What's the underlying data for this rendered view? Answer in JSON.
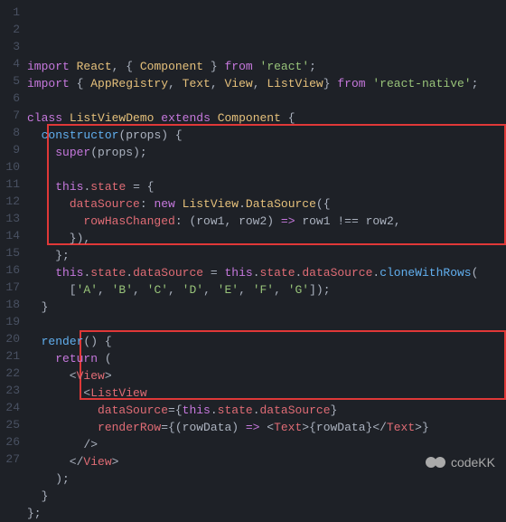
{
  "watermark": "codeKK",
  "lines": [
    {
      "num": "1",
      "tokens": [
        [
          "kw",
          "import"
        ],
        [
          "punc",
          " "
        ],
        [
          "cls",
          "React"
        ],
        [
          "punc",
          ", { "
        ],
        [
          "cls",
          "Component"
        ],
        [
          "punc",
          " } "
        ],
        [
          "kw",
          "from"
        ],
        [
          "punc",
          " "
        ],
        [
          "str",
          "'react'"
        ],
        [
          "punc",
          ";"
        ]
      ]
    },
    {
      "num": "2",
      "tokens": [
        [
          "kw",
          "import"
        ],
        [
          "punc",
          " { "
        ],
        [
          "cls",
          "AppRegistry"
        ],
        [
          "punc",
          ", "
        ],
        [
          "cls",
          "Text"
        ],
        [
          "punc",
          ", "
        ],
        [
          "cls",
          "View"
        ],
        [
          "punc",
          ", "
        ],
        [
          "cls",
          "ListView"
        ],
        [
          "punc",
          "} "
        ],
        [
          "kw",
          "from"
        ],
        [
          "punc",
          " "
        ],
        [
          "str",
          "'react-native'"
        ],
        [
          "punc",
          ";"
        ]
      ]
    },
    {
      "num": "3",
      "tokens": []
    },
    {
      "num": "4",
      "tokens": [
        [
          "kw",
          "class"
        ],
        [
          "punc",
          " "
        ],
        [
          "cls",
          "ListViewDemo"
        ],
        [
          "punc",
          " "
        ],
        [
          "kw",
          "extends"
        ],
        [
          "punc",
          " "
        ],
        [
          "cls",
          "Component"
        ],
        [
          "punc",
          " {"
        ]
      ]
    },
    {
      "num": "5",
      "tokens": [
        [
          "punc",
          "  "
        ],
        [
          "fn",
          "constructor"
        ],
        [
          "punc",
          "("
        ],
        [
          "param",
          "props"
        ],
        [
          "punc",
          ") {"
        ]
      ]
    },
    {
      "num": "6",
      "tokens": [
        [
          "punc",
          "    "
        ],
        [
          "kw",
          "super"
        ],
        [
          "punc",
          "("
        ],
        [
          "param",
          "props"
        ],
        [
          "punc",
          ");"
        ]
      ]
    },
    {
      "num": "7",
      "tokens": []
    },
    {
      "num": "8",
      "tokens": [
        [
          "punc",
          "    "
        ],
        [
          "kw",
          "this"
        ],
        [
          "punc",
          "."
        ],
        [
          "prop",
          "state"
        ],
        [
          "punc",
          " = {"
        ]
      ]
    },
    {
      "num": "9",
      "tokens": [
        [
          "punc",
          "      "
        ],
        [
          "prop",
          "dataSource"
        ],
        [
          "punc",
          ": "
        ],
        [
          "kw",
          "new"
        ],
        [
          "punc",
          " "
        ],
        [
          "cls",
          "ListView"
        ],
        [
          "punc",
          "."
        ],
        [
          "cls",
          "DataSource"
        ],
        [
          "punc",
          "({"
        ]
      ]
    },
    {
      "num": "10",
      "tokens": [
        [
          "punc",
          "        "
        ],
        [
          "prop",
          "rowHasChanged"
        ],
        [
          "punc",
          ": ("
        ],
        [
          "param",
          "row1"
        ],
        [
          "punc",
          ", "
        ],
        [
          "param",
          "row2"
        ],
        [
          "punc",
          ") "
        ],
        [
          "kw",
          "=>"
        ],
        [
          "punc",
          " "
        ],
        [
          "param",
          "row1"
        ],
        [
          "punc",
          " !== "
        ],
        [
          "param",
          "row2"
        ],
        [
          "punc",
          ","
        ]
      ]
    },
    {
      "num": "11",
      "tokens": [
        [
          "punc",
          "      }),"
        ]
      ]
    },
    {
      "num": "12",
      "tokens": [
        [
          "punc",
          "    };"
        ]
      ]
    },
    {
      "num": "13",
      "tokens": [
        [
          "punc",
          "    "
        ],
        [
          "kw",
          "this"
        ],
        [
          "punc",
          "."
        ],
        [
          "prop",
          "state"
        ],
        [
          "punc",
          "."
        ],
        [
          "prop",
          "dataSource"
        ],
        [
          "punc",
          " = "
        ],
        [
          "kw",
          "this"
        ],
        [
          "punc",
          "."
        ],
        [
          "prop",
          "state"
        ],
        [
          "punc",
          "."
        ],
        [
          "prop",
          "dataSource"
        ],
        [
          "punc",
          "."
        ],
        [
          "fn",
          "cloneWithRows"
        ],
        [
          "punc",
          "("
        ]
      ]
    },
    {
      "num": "14",
      "tokens": [
        [
          "punc",
          "      ["
        ],
        [
          "str",
          "'A'"
        ],
        [
          "punc",
          ", "
        ],
        [
          "str",
          "'B'"
        ],
        [
          "punc",
          ", "
        ],
        [
          "str",
          "'C'"
        ],
        [
          "punc",
          ", "
        ],
        [
          "str",
          "'D'"
        ],
        [
          "punc",
          ", "
        ],
        [
          "str",
          "'E'"
        ],
        [
          "punc",
          ", "
        ],
        [
          "str",
          "'F'"
        ],
        [
          "punc",
          ", "
        ],
        [
          "str",
          "'G'"
        ],
        [
          "punc",
          "]);"
        ]
      ]
    },
    {
      "num": "15",
      "tokens": [
        [
          "punc",
          "  }"
        ]
      ]
    },
    {
      "num": "16",
      "tokens": []
    },
    {
      "num": "17",
      "tokens": [
        [
          "punc",
          "  "
        ],
        [
          "fn",
          "render"
        ],
        [
          "punc",
          "() {"
        ]
      ]
    },
    {
      "num": "18",
      "tokens": [
        [
          "punc",
          "    "
        ],
        [
          "kw",
          "return"
        ],
        [
          "punc",
          " ("
        ]
      ]
    },
    {
      "num": "19",
      "tokens": [
        [
          "punc",
          "      <"
        ],
        [
          "tag",
          "View"
        ],
        [
          "punc",
          ">"
        ]
      ]
    },
    {
      "num": "20",
      "tokens": [
        [
          "punc",
          "        <"
        ],
        [
          "tag",
          "ListView"
        ]
      ]
    },
    {
      "num": "21",
      "tokens": [
        [
          "punc",
          "          "
        ],
        [
          "prop",
          "dataSource"
        ],
        [
          "punc",
          "={"
        ],
        [
          "kw",
          "this"
        ],
        [
          "punc",
          "."
        ],
        [
          "prop",
          "state"
        ],
        [
          "punc",
          "."
        ],
        [
          "prop",
          "dataSource"
        ],
        [
          "punc",
          "}"
        ]
      ]
    },
    {
      "num": "22",
      "tokens": [
        [
          "punc",
          "          "
        ],
        [
          "prop",
          "renderRow"
        ],
        [
          "punc",
          "={("
        ],
        [
          "param",
          "rowData"
        ],
        [
          "punc",
          ") "
        ],
        [
          "kw",
          "=>"
        ],
        [
          "punc",
          " <"
        ],
        [
          "tag",
          "Text"
        ],
        [
          "punc",
          ">{"
        ],
        [
          "param",
          "rowData"
        ],
        [
          "punc",
          "}</"
        ],
        [
          "tag",
          "Text"
        ],
        [
          "punc",
          ">}"
        ]
      ]
    },
    {
      "num": "23",
      "tokens": [
        [
          "punc",
          "        />"
        ]
      ]
    },
    {
      "num": "24",
      "tokens": [
        [
          "punc",
          "      </"
        ],
        [
          "tag",
          "View"
        ],
        [
          "punc",
          ">"
        ]
      ]
    },
    {
      "num": "25",
      "tokens": [
        [
          "punc",
          "    );"
        ]
      ]
    },
    {
      "num": "26",
      "tokens": [
        [
          "punc",
          "  }"
        ]
      ]
    },
    {
      "num": "27",
      "tokens": [
        [
          "punc",
          "};"
        ]
      ]
    }
  ]
}
